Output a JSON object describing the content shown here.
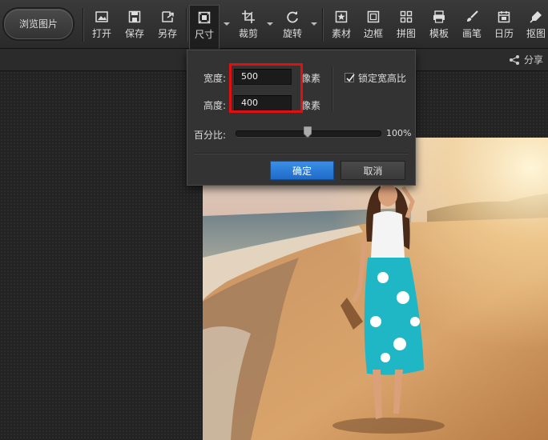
{
  "toolbar": {
    "browse_label": "浏览图片",
    "tools": [
      {
        "label": "打开",
        "icon": "open-icon"
      },
      {
        "label": "保存",
        "icon": "save-icon"
      },
      {
        "label": "另存",
        "icon": "save-as-icon"
      },
      {
        "label": "尺寸",
        "icon": "resize-icon",
        "active": true
      },
      {
        "label": "裁剪",
        "icon": "crop-icon"
      },
      {
        "label": "旋转",
        "icon": "rotate-icon"
      },
      {
        "label": "素材",
        "icon": "sticker-icon"
      },
      {
        "label": "边框",
        "icon": "frame-icon"
      },
      {
        "label": "拼图",
        "icon": "collage-icon"
      },
      {
        "label": "模板",
        "icon": "template-icon"
      },
      {
        "label": "画笔",
        "icon": "brush-icon"
      },
      {
        "label": "日历",
        "icon": "calendar-icon"
      },
      {
        "label": "抠图",
        "icon": "cutout-icon"
      }
    ]
  },
  "subbar": {
    "share_label": "分享"
  },
  "resize_dialog": {
    "width_label": "宽度:",
    "width_value": "500",
    "height_label": "高度:",
    "height_value": "400",
    "unit": "像素",
    "lock_label": "锁定宽高比",
    "lock_checked": true,
    "percent_label": "百分比:",
    "percent_value": "100%",
    "slider_position_fraction": 0.5,
    "ok_label": "确定",
    "cancel_label": "取消"
  },
  "colors": {
    "highlight": "#dd1111",
    "primary_button": "#2a7ad8"
  }
}
